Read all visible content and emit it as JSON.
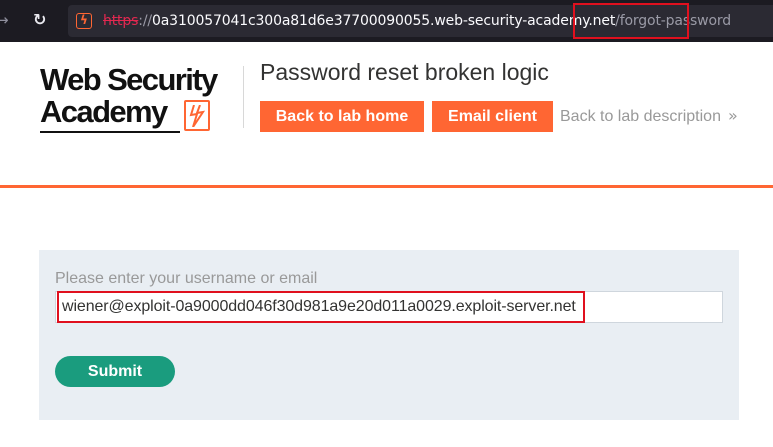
{
  "browser": {
    "forward_glyph": "→",
    "reload_glyph": "↻",
    "site_icon_glyph": "ϟ",
    "url_scheme": "https",
    "url_separator": "://",
    "url_host": "0a310057041c300a81d6e37700090055.web-security-academy.net",
    "url_path": "/forgot-password"
  },
  "header": {
    "logo_line1": "Web Security",
    "logo_line2": "Academy",
    "lab_title": "Password reset broken logic",
    "back_to_lab_home": "Back to lab home",
    "email_client": "Email client",
    "back_to_lab_description": "Back to lab description",
    "back_arrow_glyph": "»"
  },
  "form": {
    "label": "Please enter your username or email",
    "input_value": "wiener@exploit-0a9000dd046f30d981a9e20d011a0029.exploit-server.net",
    "submit_label": "Submit"
  },
  "colors": {
    "brand_orange": "#ff6633",
    "submit_green": "#1a9c7e",
    "highlight_red": "#e0101e",
    "browser_bg": "#1c1b22"
  },
  "icons": [
    "forward-arrow-icon",
    "reload-icon",
    "site-favicon-icon",
    "logo-lightning-icon",
    "double-chevron-right-icon"
  ]
}
